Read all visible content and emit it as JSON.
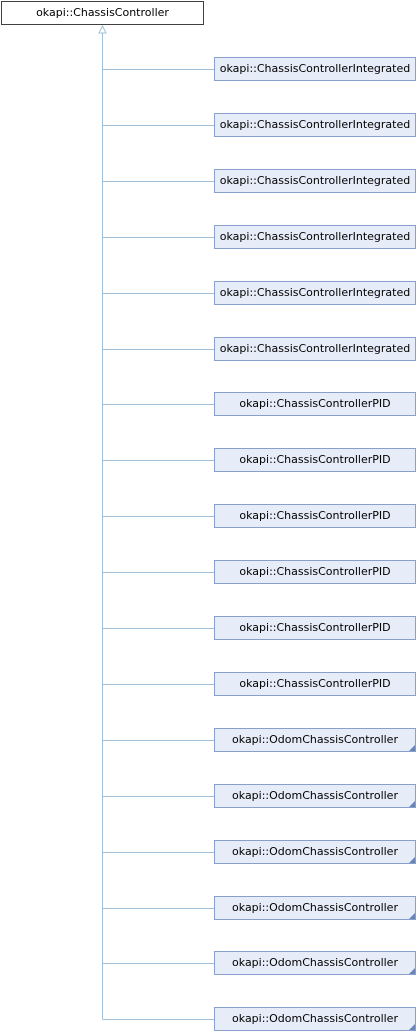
{
  "base": {
    "label": "okapi::ChassisController"
  },
  "children": [
    {
      "label": "okapi::ChassisControllerIntegrated",
      "has_more": false
    },
    {
      "label": "okapi::ChassisControllerIntegrated",
      "has_more": false
    },
    {
      "label": "okapi::ChassisControllerIntegrated",
      "has_more": false
    },
    {
      "label": "okapi::ChassisControllerIntegrated",
      "has_more": false
    },
    {
      "label": "okapi::ChassisControllerIntegrated",
      "has_more": false
    },
    {
      "label": "okapi::ChassisControllerIntegrated",
      "has_more": false
    },
    {
      "label": "okapi::ChassisControllerPID",
      "has_more": false
    },
    {
      "label": "okapi::ChassisControllerPID",
      "has_more": false
    },
    {
      "label": "okapi::ChassisControllerPID",
      "has_more": false
    },
    {
      "label": "okapi::ChassisControllerPID",
      "has_more": false
    },
    {
      "label": "okapi::ChassisControllerPID",
      "has_more": false
    },
    {
      "label": "okapi::ChassisControllerPID",
      "has_more": false
    },
    {
      "label": "okapi::OdomChassisController",
      "has_more": true
    },
    {
      "label": "okapi::OdomChassisController",
      "has_more": true
    },
    {
      "label": "okapi::OdomChassisController",
      "has_more": true
    },
    {
      "label": "okapi::OdomChassisController",
      "has_more": true
    },
    {
      "label": "okapi::OdomChassisController",
      "has_more": true
    },
    {
      "label": "okapi::OdomChassisController",
      "has_more": true
    }
  ],
  "colors": {
    "edge": "#9fc0d8",
    "child_fill": "#e6ecf8",
    "child_border": "#8aa0cc",
    "base_border": "#404040"
  }
}
